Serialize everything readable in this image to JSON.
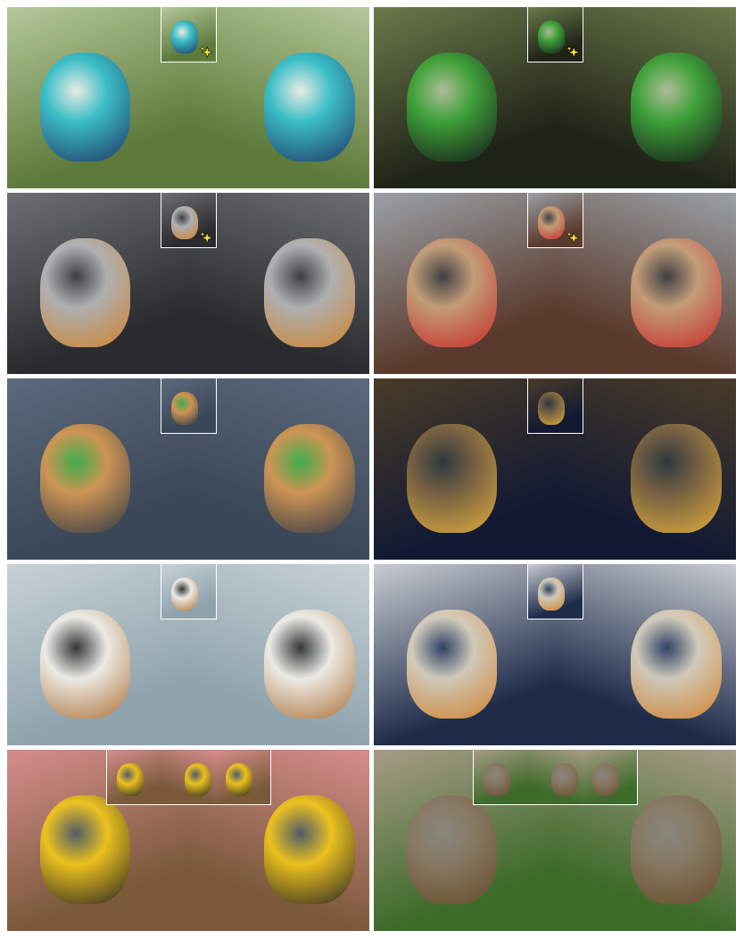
{
  "figure": {
    "rows": 5,
    "columns": 2,
    "sparkle_icon": "sparkle-icon",
    "panels": [
      {
        "id": "crochet-bee",
        "thumbnail": "single",
        "sparkle": true,
        "colors": {
          "bg1": "#5d7a3a",
          "bg2": "#b4c79a",
          "subject": "#35c1cf",
          "accent": "#1a2f6b",
          "extra": "#f2f2ee"
        }
      },
      {
        "id": "goblin",
        "thumbnail": "single",
        "sparkle": true,
        "colors": {
          "bg1": "#1f2418",
          "bg2": "#6b7a4a",
          "subject": "#3fa83a",
          "accent": "#15171a",
          "extra": "#b7c7a0"
        }
      },
      {
        "id": "robot",
        "thumbnail": "single",
        "sparkle": true,
        "colors": {
          "bg1": "#2a2b2d",
          "bg2": "#6d6f73",
          "subject": "#b7b9bb",
          "accent": "#e08a2a",
          "extra": "#3d3f42"
        }
      },
      {
        "id": "teddy-bear",
        "thumbnail": "single",
        "sparkle": true,
        "colors": {
          "bg1": "#5a3a2c",
          "bg2": "#9aa0a6",
          "subject": "#c9a27a",
          "accent": "#d22a2a",
          "extra": "#3b3d44"
        }
      },
      {
        "id": "golden-retriever",
        "thumbnail": "single",
        "sparkle": false,
        "colors": {
          "bg1": "#3a4758",
          "bg2": "#5b6a7c",
          "subject": "#d99a52",
          "accent": "#2d3646",
          "extra": "#3fb34a"
        }
      },
      {
        "id": "stone-bridge",
        "thumbnail": "single",
        "sparkle": false,
        "colors": {
          "bg1": "#121a33",
          "bg2": "#4a3b28",
          "subject": "#7b6445",
          "accent": "#f2b83a",
          "extra": "#2f3a3f"
        }
      },
      {
        "id": "sheep",
        "thumbnail": "single",
        "sparkle": false,
        "colors": {
          "bg1": "#8fa3ad",
          "bg2": "#c7d1d6",
          "subject": "#f1efe8",
          "accent": "#b06a2a",
          "extra": "#2a2c2e"
        }
      },
      {
        "id": "espresso-martinis",
        "thumbnail": "single",
        "sparkle": false,
        "colors": {
          "bg1": "#1e2c4a",
          "bg2": "#c8ccd1",
          "subject": "#dad2c0",
          "accent": "#e08a2a",
          "extra": "#2a3e63"
        }
      },
      {
        "id": "lego-bulldozer",
        "thumbnail": "triple",
        "sparkle": false,
        "colors": {
          "bg1": "#7a5a3a",
          "bg2": "#d68c8c",
          "subject": "#f2c81a",
          "accent": "#202020",
          "extra": "#4a5a6a"
        }
      },
      {
        "id": "garden-table",
        "thumbnail": "triple",
        "sparkle": false,
        "colors": {
          "bg1": "#3d6b2a",
          "bg2": "#a79b86",
          "subject": "#8a7966",
          "accent": "#6b4a2a",
          "extra": "#8c8680"
        }
      }
    ]
  }
}
